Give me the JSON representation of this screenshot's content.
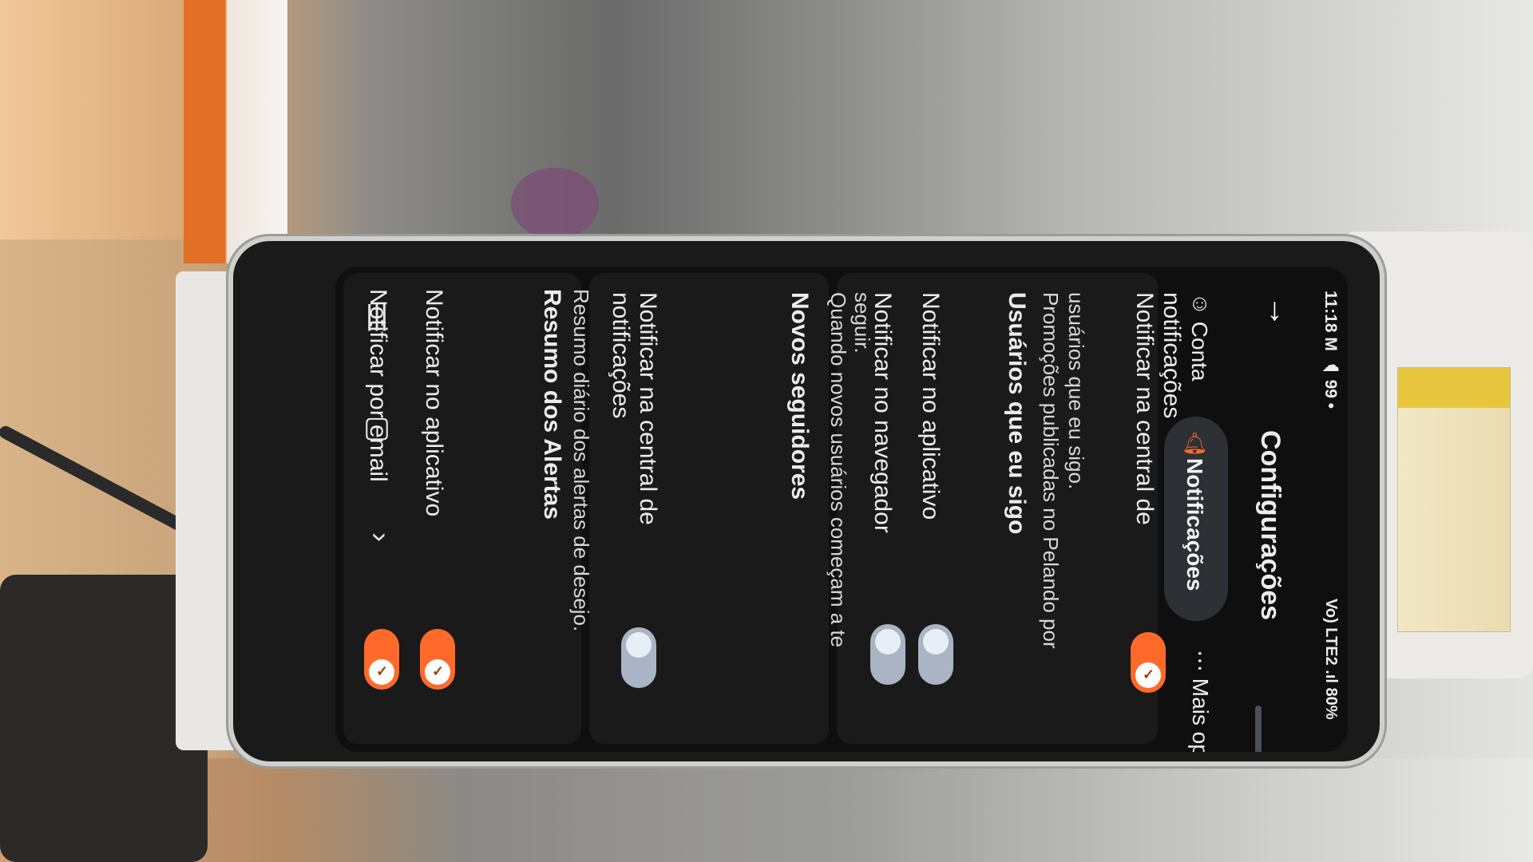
{
  "status": {
    "time": "11:18",
    "icons_left": "M ☁ 99 •",
    "battery": "80%",
    "icons_right": "Vo) LTE2 .ıl"
  },
  "header": {
    "title": "Configurações"
  },
  "tabs": [
    {
      "label": "Conta",
      "icon": "account-icon"
    },
    {
      "label": "Notificações",
      "icon": "bell-icon",
      "active": true
    },
    {
      "label": "Mais opç",
      "icon": "more-icon"
    }
  ],
  "sections": [
    {
      "title": "Usuários que eu sigo",
      "description_line1": "Promoções publicadas no Pelando por",
      "description_line2": "usuários que eu sigo.",
      "items": [
        {
          "label_line1": "Notificar na central de",
          "label_line2": "notificações",
          "enabled": true
        },
        {
          "label_line1": "Notificar no aplicativo",
          "label_line2": "",
          "enabled": false
        },
        {
          "label_line1": "Notificar no navegador",
          "label_line2": "",
          "enabled": false
        }
      ]
    },
    {
      "title": "Novos seguidores",
      "description_line1": "Quando novos usuários começam a te",
      "description_line2": "seguir.",
      "items": [
        {
          "label_line1": "Notificar na central de",
          "label_line2": "notificações",
          "enabled": false
        }
      ]
    },
    {
      "title": "Resumo dos Alertas",
      "description_line1": "Resumo diário dos alertas de desejo.",
      "description_line2": "",
      "items": [
        {
          "label_line1": "Notificar no aplicativo",
          "label_line2": "",
          "enabled": true
        },
        {
          "label_line1": "Notificar por email",
          "label_line2": "",
          "enabled": true
        }
      ]
    }
  ],
  "colors": {
    "accent": "#ff6a2a",
    "toggle_off": "#a9b5c4",
    "background": "#0f0f10",
    "panel": "#1a1a1b"
  }
}
